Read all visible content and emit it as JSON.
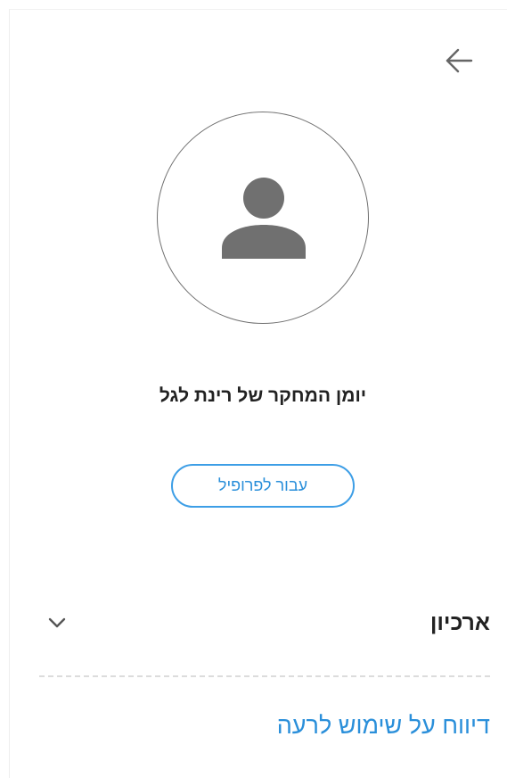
{
  "header": {
    "back_icon": "arrow-left-icon"
  },
  "profile": {
    "avatar_icon": "person-icon",
    "journal_title": "יומן המחקר של רינת לגל",
    "profile_button_label": "עבור לפרופיל"
  },
  "archive": {
    "label": "ארכיון",
    "expand_icon": "chevron-down-icon"
  },
  "report": {
    "link_label": "דיווח על שימוש לרעה"
  },
  "colors": {
    "accent": "#2a8fda",
    "icon_gray": "#707070",
    "text": "#222222",
    "divider": "#dcdcdc"
  }
}
